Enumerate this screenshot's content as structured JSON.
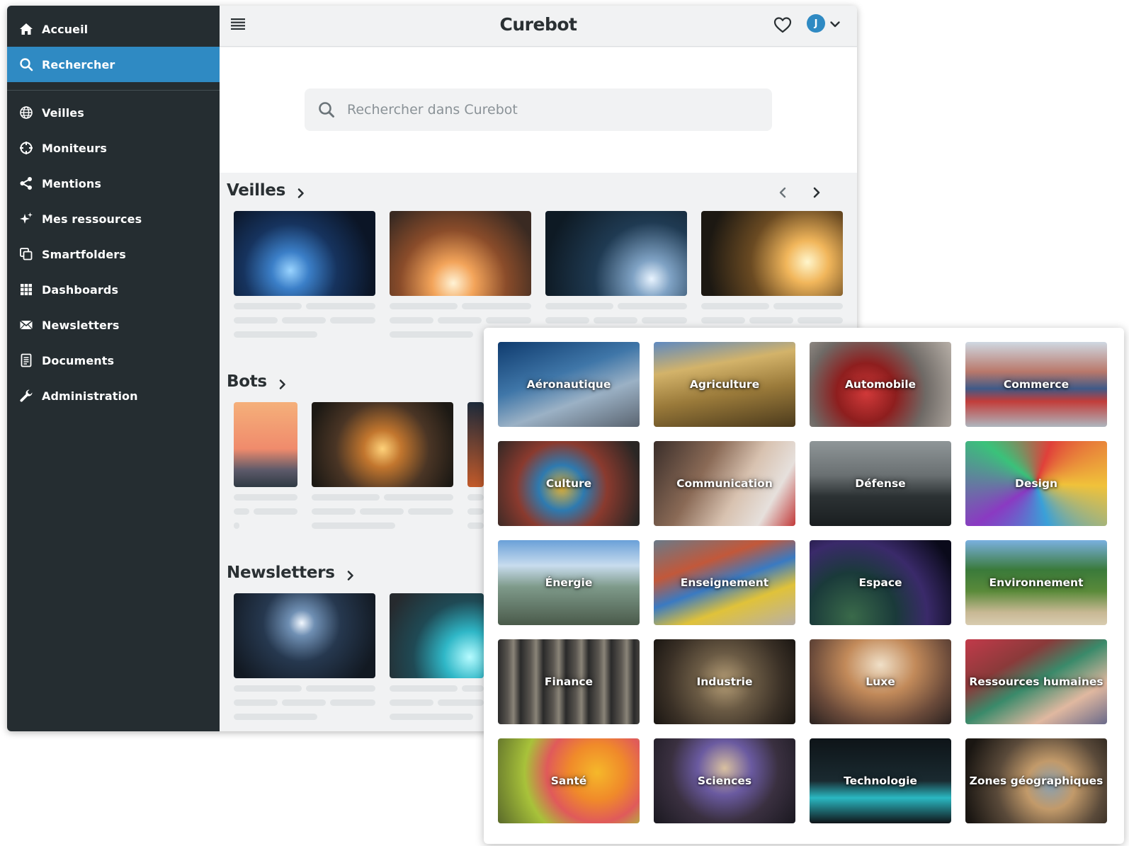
{
  "sidebar": {
    "items": [
      {
        "name": "accueil",
        "label": "Accueil",
        "icon": "home-icon"
      },
      {
        "name": "rechercher",
        "label": "Rechercher",
        "icon": "search-icon"
      },
      {
        "name": "veilles",
        "label": "Veilles",
        "icon": "globe-icon"
      },
      {
        "name": "moniteurs",
        "label": "Moniteurs",
        "icon": "crosshair-icon"
      },
      {
        "name": "mentions",
        "label": "Mentions",
        "icon": "share-icon"
      },
      {
        "name": "mes-ressources",
        "label": "Mes ressources",
        "icon": "sparkle-icon"
      },
      {
        "name": "smartfolders",
        "label": "Smartfolders",
        "icon": "folders-icon"
      },
      {
        "name": "dashboards",
        "label": "Dashboards",
        "icon": "grid-icon"
      },
      {
        "name": "newsletters",
        "label": "Newsletters",
        "icon": "envelope-icon"
      },
      {
        "name": "documents",
        "label": "Documents",
        "icon": "document-icon"
      },
      {
        "name": "administration",
        "label": "Administration",
        "icon": "wrench-icon"
      }
    ],
    "active": "Rechercher"
  },
  "header": {
    "brand": "Curebot",
    "avatar_initial": "J"
  },
  "search": {
    "placeholder": "Rechercher dans Curebot"
  },
  "sections": {
    "veilles": {
      "title": "Veilles"
    },
    "bots": {
      "title": "Bots"
    },
    "newsletters": {
      "title": "Newsletters"
    }
  },
  "categories": [
    "Aéronautique",
    "Agriculture",
    "Automobile",
    "Commerce",
    "Culture",
    "Communication",
    "Défense",
    "Design",
    "Énergie",
    "Enseignement",
    "Espace",
    "Environnement",
    "Finance",
    "Industrie",
    "Luxe",
    "Ressources humaines",
    "Santé",
    "Sciences",
    "Technologie",
    "Zones géographiques"
  ],
  "colors": {
    "sidebar_bg": "#252d31",
    "accent": "#2f8ac3",
    "content_bg": "#f1f2f3"
  }
}
